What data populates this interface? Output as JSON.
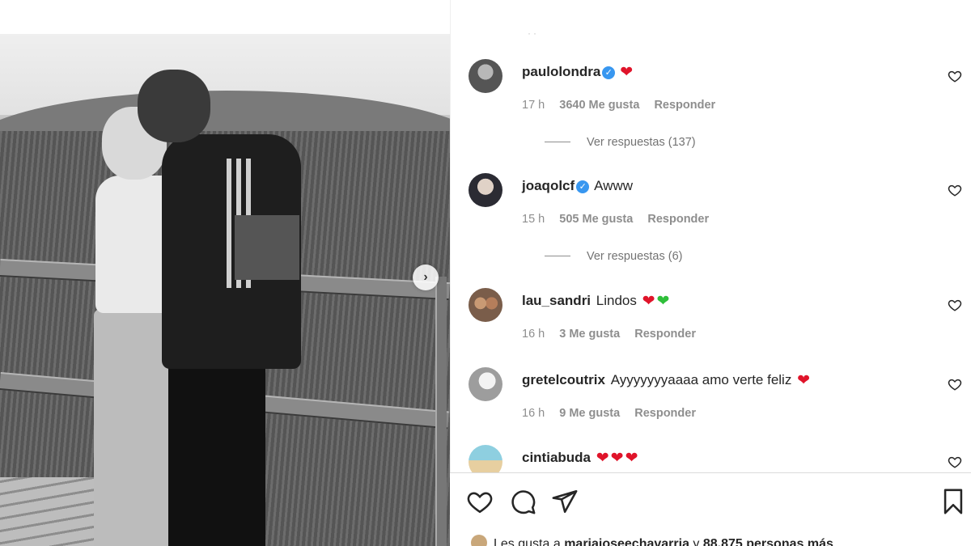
{
  "photo": {
    "alt_icon": "chevron-right-icon"
  },
  "comments": [
    {
      "username": "paulolondra",
      "verified": true,
      "text": "",
      "emojis": [
        "red-heart"
      ],
      "time": "17 h",
      "likes": "3640 Me gusta",
      "reply_label": "Responder",
      "view_replies": "Ver respuestas (137)"
    },
    {
      "username": "joaqolcf",
      "verified": true,
      "text": "Awww",
      "emojis": [],
      "time": "15 h",
      "likes": "505 Me gusta",
      "reply_label": "Responder",
      "view_replies": "Ver respuestas (6)"
    },
    {
      "username": "lau_sandri",
      "verified": false,
      "text": "Lindos",
      "emojis": [
        "red-heart",
        "green-heart"
      ],
      "time": "16 h",
      "likes": "3 Me gusta",
      "reply_label": "Responder"
    },
    {
      "username": "gretelcoutrix",
      "verified": false,
      "text": "Ayyyyyyyaaaa amo verte feliz",
      "emojis": [
        "red-heart"
      ],
      "time": "16 h",
      "likes": "9 Me gusta",
      "reply_label": "Responder"
    },
    {
      "username": "cintiabuda",
      "verified": false,
      "text": "",
      "emojis": [
        "red-heart",
        "red-heart",
        "red-heart"
      ]
    }
  ],
  "actions": {
    "like_icon": "heart-outline-icon",
    "comment_icon": "comment-bubble-icon",
    "share_icon": "paper-plane-icon",
    "save_icon": "bookmark-icon"
  },
  "liked_by": {
    "prefix": "Les gusta a",
    "user": "mariajoseechavarria",
    "connector": "y",
    "count": "88.875 personas más"
  },
  "colors": {
    "verified": "#3897f0",
    "heart_red": "#e0142a",
    "heart_green": "#2fbf3a",
    "meta_gray": "#8e8e8e"
  }
}
